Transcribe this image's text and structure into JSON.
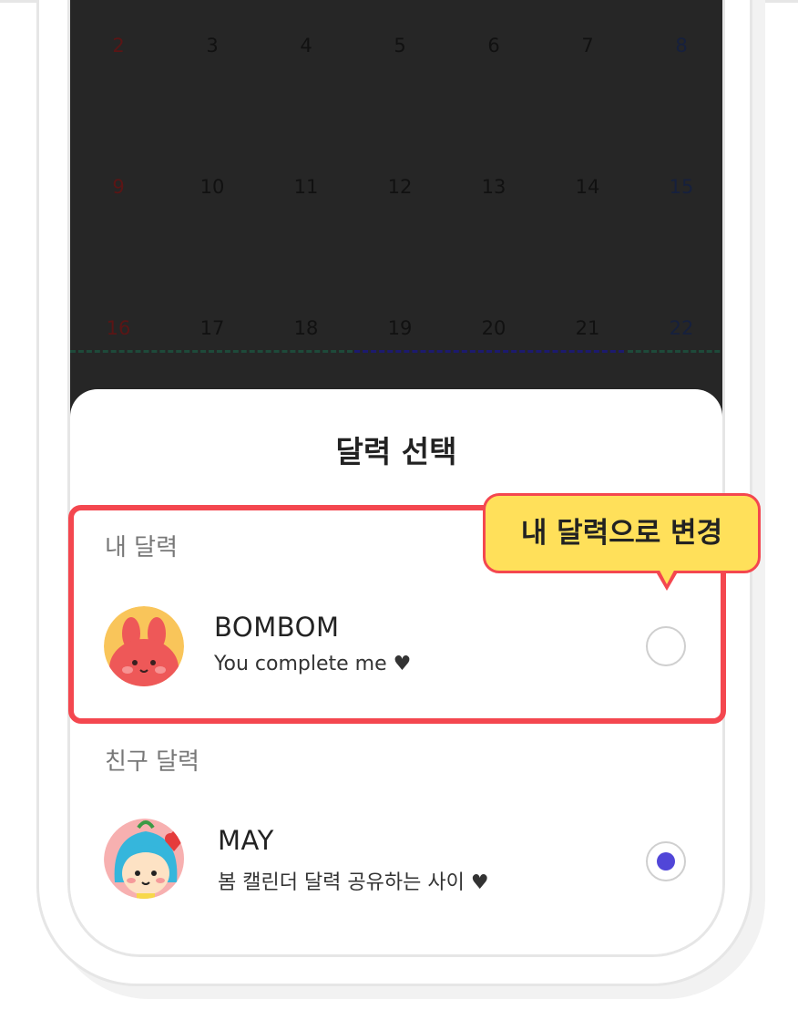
{
  "calendar": {
    "week1": [
      "2",
      "3",
      "4",
      "5",
      "6",
      "7",
      "8"
    ],
    "week2": [
      "9",
      "10",
      "11",
      "12",
      "13",
      "14",
      "15"
    ],
    "week3": [
      "16",
      "17",
      "18",
      "19",
      "20",
      "21",
      "22"
    ]
  },
  "sheet": {
    "title": "달력 선택",
    "my_section_label": "내 달력",
    "friend_section_label": "친구 달력"
  },
  "my_calendar": {
    "name": "BOMBOM",
    "description": "You complete me ♥",
    "selected": false
  },
  "friend_calendar": {
    "name": "MAY",
    "description": "봄 캘린더 달력 공유하는 사이 ♥",
    "selected": true
  },
  "tooltip": {
    "text": "내 달력으로 변경"
  },
  "colors": {
    "highlight": "#f4474f",
    "tooltip_bg": "#ffe05a",
    "radio_selected": "#5146d8",
    "overlay": "#262626"
  }
}
